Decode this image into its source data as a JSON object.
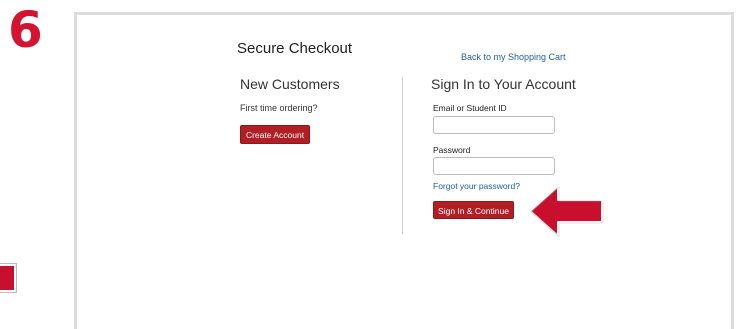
{
  "step": {
    "number": "6"
  },
  "checkout": {
    "title": "Secure Checkout",
    "back_link": "Back to my Shopping Cart"
  },
  "new_customers": {
    "heading": "New Customers",
    "prompt": "First time ordering?",
    "create_button": "Create Account"
  },
  "sign_in": {
    "heading": "Sign In to Your Account",
    "email_label": "Email or Student ID",
    "email_value": "",
    "password_label": "Password",
    "password_value": "",
    "forgot_link": "Forgot your password?",
    "submit_button": "Sign In & Continue"
  },
  "colors": {
    "step_number": "#d3132f",
    "button": "#b11f24",
    "link": "#1f5f9e",
    "arrow": "#c8102e"
  },
  "icons": {
    "callout": "left-arrow-icon"
  }
}
